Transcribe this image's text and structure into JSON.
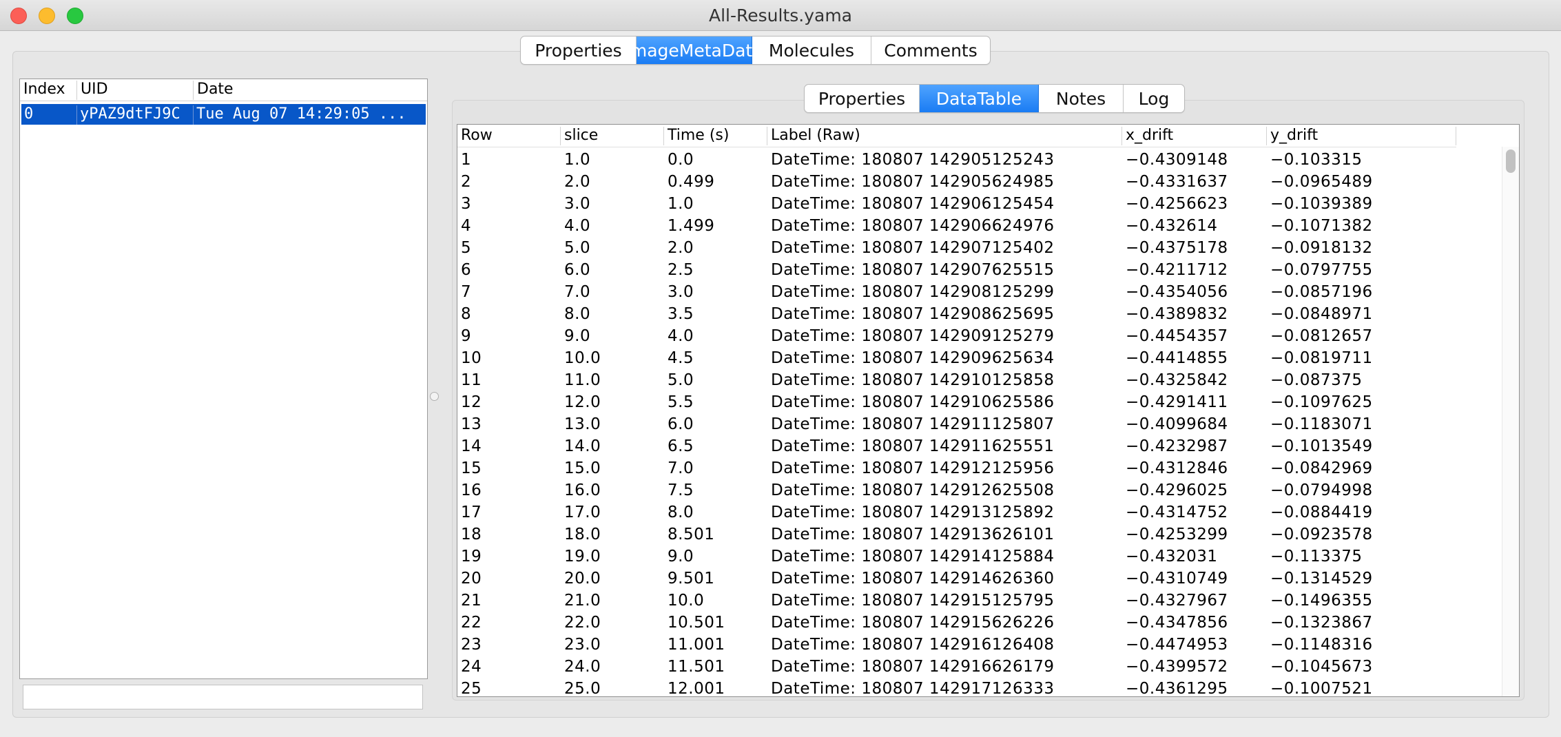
{
  "window": {
    "title": "All-Results.yama"
  },
  "main_tabs": [
    {
      "label": "Properties",
      "active": false
    },
    {
      "label": "ImageMetaData",
      "active": true
    },
    {
      "label": "Molecules",
      "active": false
    },
    {
      "label": "Comments",
      "active": false
    }
  ],
  "sub_tabs": [
    {
      "label": "Properties",
      "active": false
    },
    {
      "label": "DataTable",
      "active": true
    },
    {
      "label": "Notes",
      "active": false
    },
    {
      "label": "Log",
      "active": false
    }
  ],
  "metadata_table": {
    "columns": [
      "Index",
      "UID",
      "Date"
    ],
    "rows": [
      {
        "index": "0",
        "uid": "yPAZ9dtFJ9C",
        "date": "Tue Aug 07 14:29:05 ...",
        "selected": true
      }
    ]
  },
  "search": {
    "value": ""
  },
  "data_table": {
    "columns": [
      "Row",
      "slice",
      "Time (s)",
      "Label (Raw)",
      "x_drift",
      "y_drift"
    ],
    "rows": [
      [
        "1",
        "1.0",
        "0.0",
        "DateTime: 180807 142905125243",
        "−0.4309148",
        "−0.103315"
      ],
      [
        "2",
        "2.0",
        "0.499",
        "DateTime: 180807 142905624985",
        "−0.4331637",
        "−0.0965489"
      ],
      [
        "3",
        "3.0",
        "1.0",
        "DateTime: 180807 142906125454",
        "−0.4256623",
        "−0.1039389"
      ],
      [
        "4",
        "4.0",
        "1.499",
        "DateTime: 180807 142906624976",
        "−0.432614",
        "−0.1071382"
      ],
      [
        "5",
        "5.0",
        "2.0",
        "DateTime: 180807 142907125402",
        "−0.4375178",
        "−0.0918132"
      ],
      [
        "6",
        "6.0",
        "2.5",
        "DateTime: 180807 142907625515",
        "−0.4211712",
        "−0.0797755"
      ],
      [
        "7",
        "7.0",
        "3.0",
        "DateTime: 180807 142908125299",
        "−0.4354056",
        "−0.0857196"
      ],
      [
        "8",
        "8.0",
        "3.5",
        "DateTime: 180807 142908625695",
        "−0.4389832",
        "−0.0848971"
      ],
      [
        "9",
        "9.0",
        "4.0",
        "DateTime: 180807 142909125279",
        "−0.4454357",
        "−0.0812657"
      ],
      [
        "10",
        "10.0",
        "4.5",
        "DateTime: 180807 142909625634",
        "−0.4414855",
        "−0.0819711"
      ],
      [
        "11",
        "11.0",
        "5.0",
        "DateTime: 180807 142910125858",
        "−0.4325842",
        "−0.087375"
      ],
      [
        "12",
        "12.0",
        "5.5",
        "DateTime: 180807 142910625586",
        "−0.4291411",
        "−0.1097625"
      ],
      [
        "13",
        "13.0",
        "6.0",
        "DateTime: 180807 142911125807",
        "−0.4099684",
        "−0.1183071"
      ],
      [
        "14",
        "14.0",
        "6.5",
        "DateTime: 180807 142911625551",
        "−0.4232987",
        "−0.1013549"
      ],
      [
        "15",
        "15.0",
        "7.0",
        "DateTime: 180807 142912125956",
        "−0.4312846",
        "−0.0842969"
      ],
      [
        "16",
        "16.0",
        "7.5",
        "DateTime: 180807 142912625508",
        "−0.4296025",
        "−0.0794998"
      ],
      [
        "17",
        "17.0",
        "8.0",
        "DateTime: 180807 142913125892",
        "−0.4314752",
        "−0.0884419"
      ],
      [
        "18",
        "18.0",
        "8.501",
        "DateTime: 180807 142913626101",
        "−0.4253299",
        "−0.0923578"
      ],
      [
        "19",
        "19.0",
        "9.0",
        "DateTime: 180807 142914125884",
        "−0.432031",
        "−0.113375"
      ],
      [
        "20",
        "20.0",
        "9.501",
        "DateTime: 180807 142914626360",
        "−0.4310749",
        "−0.1314529"
      ],
      [
        "21",
        "21.0",
        "10.0",
        "DateTime: 180807 142915125795",
        "−0.4327967",
        "−0.1496355"
      ],
      [
        "22",
        "22.0",
        "10.501",
        "DateTime: 180807 142915626226",
        "−0.4347856",
        "−0.1323867"
      ],
      [
        "23",
        "23.0",
        "11.001",
        "DateTime: 180807 142916126408",
        "−0.4474953",
        "−0.1148316"
      ],
      [
        "24",
        "24.0",
        "11.501",
        "DateTime: 180807 142916626179",
        "−0.4399572",
        "−0.1045673"
      ],
      [
        "25",
        "25.0",
        "12.001",
        "DateTime: 180807 142917126333",
        "−0.4361295",
        "−0.1007521"
      ]
    ]
  },
  "colors": {
    "accent": "#1a7cf3",
    "selection": "#0857c8"
  }
}
